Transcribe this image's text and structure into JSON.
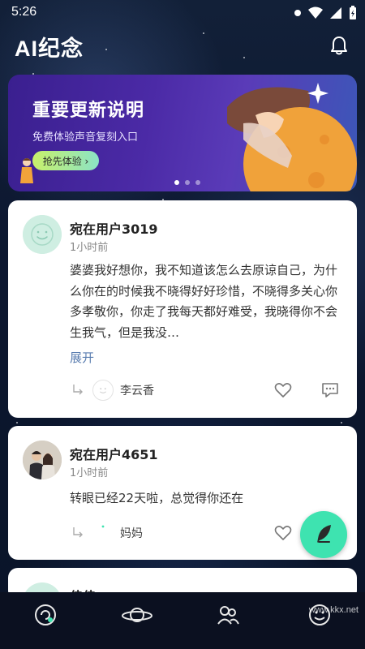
{
  "status_bar": {
    "time": "5:26"
  },
  "header": {
    "title": "AI纪念",
    "bell_icon": "bell-icon"
  },
  "banner": {
    "title": "重要更新说明",
    "subtitle": "免费体验声音复刻入口",
    "button_label": "抢先体验 ›",
    "pages": 3,
    "active_page": 1
  },
  "posts": [
    {
      "user": "宛在用户3019",
      "time": "1小时前",
      "content": "婆婆我好想你，我不知道该怎么去原谅自己，为什么你在的时候我不晓得好好珍惜，不晓得多关心你多孝敬你，你走了我每天都好难受，我晓得你不会生我气，但是我没…",
      "expand_label": "展开",
      "reply_name": "李云香"
    },
    {
      "user": "宛在用户4651",
      "time": "1小时前",
      "content": "转眼已经22天啦，总觉得你还在",
      "reply_name": "妈妈"
    },
    {
      "user": "佳佳"
    }
  ],
  "nav": {
    "items": [
      "home-icon",
      "planet-icon",
      "people-icon",
      "smile-icon"
    ],
    "active": 0
  },
  "watermark": "www.kkx.net",
  "colors": {
    "accent": "#3ee3b0",
    "link": "#5a7db0",
    "banner_start": "#3a1f8f",
    "banner_end": "#3b58b8"
  }
}
